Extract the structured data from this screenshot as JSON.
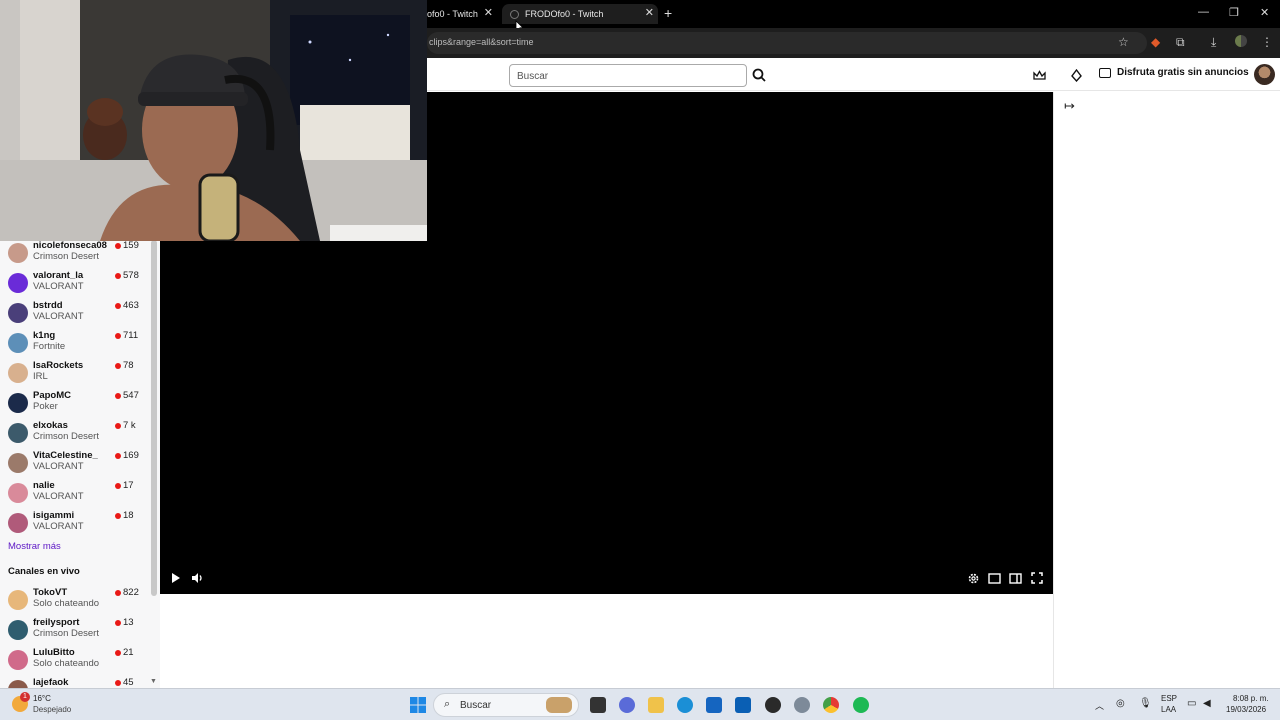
{
  "browser": {
    "tabs": [
      {
        "title": "ofo0 - Twitch"
      },
      {
        "title": "FRODOfo0 - Twitch"
      }
    ],
    "address": "clips&range=all&sort=time"
  },
  "header": {
    "search_placeholder": "Buscar",
    "adfree_label": "Disfruta gratis sin anuncios"
  },
  "sidebar": {
    "followed": [
      {
        "name": "nicolefonseca08",
        "game": "Crimson Desert",
        "viewers": "159",
        "color": "#c79a8a"
      },
      {
        "name": "valorant_la",
        "game": "VALORANT",
        "viewers": "578",
        "color": "#6a2bd8"
      },
      {
        "name": "bstrdd",
        "game": "VALORANT",
        "viewers": "463",
        "color": "#4a3f7a"
      },
      {
        "name": "k1ng",
        "game": "Fortnite",
        "viewers": "711",
        "color": "#5d8fb8"
      },
      {
        "name": "IsaRockets",
        "game": "IRL",
        "viewers": "78",
        "color": "#d8b08e"
      },
      {
        "name": "PapoMC",
        "game": "Poker",
        "viewers": "547",
        "color": "#1b2a4a"
      },
      {
        "name": "elxokas",
        "game": "Crimson Desert",
        "viewers": "7 k",
        "color": "#3c5a6b"
      },
      {
        "name": "VitaCelestine_",
        "game": "VALORANT",
        "viewers": "169",
        "color": "#9b7a6a"
      },
      {
        "name": "nalie",
        "game": "VALORANT",
        "viewers": "17",
        "color": "#d98a9a"
      },
      {
        "name": "isigammi",
        "game": "VALORANT",
        "viewers": "18",
        "color": "#b05a7a"
      }
    ],
    "show_more": "Mostrar más",
    "live_title": "Canales en vivo",
    "live": [
      {
        "name": "TokoVT",
        "game": "Solo chateando",
        "viewers": "822",
        "color": "#e7b77a"
      },
      {
        "name": "freilysport",
        "game": "Crimson Desert",
        "viewers": "13",
        "color": "#2f5d6f"
      },
      {
        "name": "LuluBitto",
        "game": "Solo chateando",
        "viewers": "21",
        "color": "#d06a8a"
      },
      {
        "name": "lajefaok",
        "game": "",
        "viewers": "45",
        "color": "#8a5a4a"
      }
    ]
  },
  "taskbar": {
    "weather_temp": "16°C",
    "weather_desc": "Despejado",
    "search_label": "Buscar",
    "lang": "ESP",
    "lang_sub": "LAA",
    "time": "8:08 p. m.",
    "date": "19/03/2026",
    "notification_count": "1"
  }
}
